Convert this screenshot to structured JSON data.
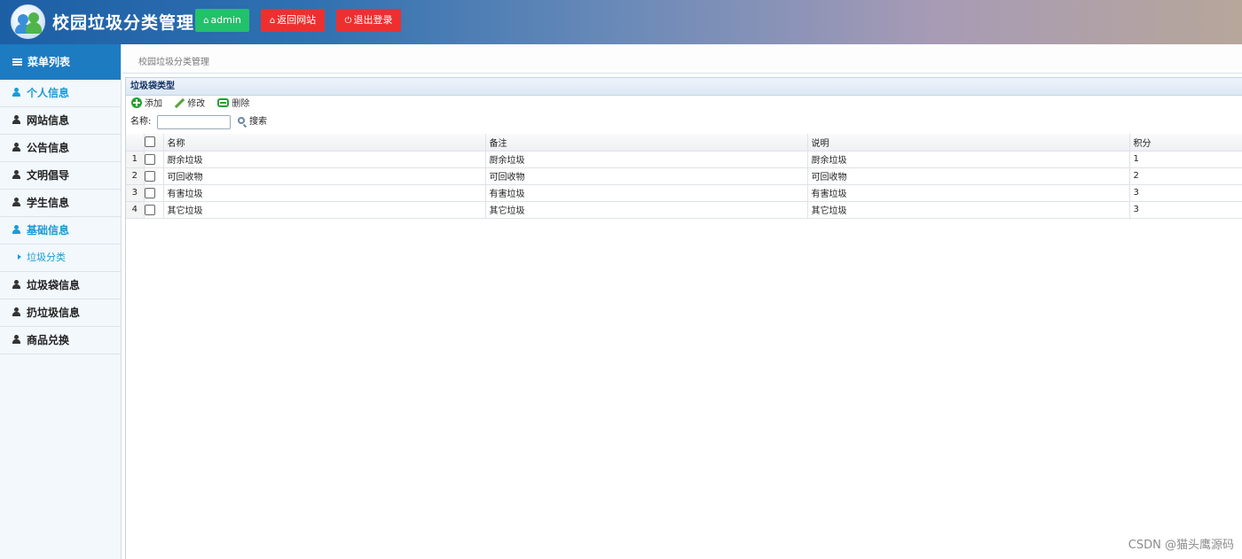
{
  "header": {
    "app_title": "校园垃圾分类管理",
    "admin_label": "admin",
    "back_label": "返回网站",
    "logout_label": "退出登录",
    "colors": {
      "admin": "#22c16b",
      "danger": "#ee2f2f"
    }
  },
  "sidebar": {
    "title": "菜单列表",
    "items": [
      {
        "label": "个人信息",
        "active": true
      },
      {
        "label": "网站信息"
      },
      {
        "label": "公告信息"
      },
      {
        "label": "文明倡导"
      },
      {
        "label": "学生信息"
      },
      {
        "label": "基础信息",
        "active": true
      },
      {
        "label": "垃圾分类",
        "sub": true
      },
      {
        "label": "垃圾袋信息"
      },
      {
        "label": "扔垃圾信息"
      },
      {
        "label": "商品兑换"
      }
    ]
  },
  "breadcrumb": "校园垃圾分类管理",
  "panel": {
    "title": "垃圾袋类型",
    "toolbar": {
      "add": "添加",
      "edit": "修改",
      "delete": "删除"
    },
    "search": {
      "label": "名称:",
      "value": "",
      "button": "搜索"
    },
    "table": {
      "columns": [
        "名称",
        "备注",
        "说明",
        "积分"
      ],
      "rows": [
        {
          "num": "1",
          "cells": [
            "厨余垃圾",
            "厨余垃圾",
            "厨余垃圾",
            "1"
          ]
        },
        {
          "num": "2",
          "cells": [
            "可回收物",
            "可回收物",
            "可回收物",
            "2"
          ]
        },
        {
          "num": "3",
          "cells": [
            "有害垃圾",
            "有害垃圾",
            "有害垃圾",
            "3"
          ]
        },
        {
          "num": "4",
          "cells": [
            "其它垃圾",
            "其它垃圾",
            "其它垃圾",
            "3"
          ]
        }
      ]
    }
  },
  "watermark": "CSDN @猫头鹰源码"
}
